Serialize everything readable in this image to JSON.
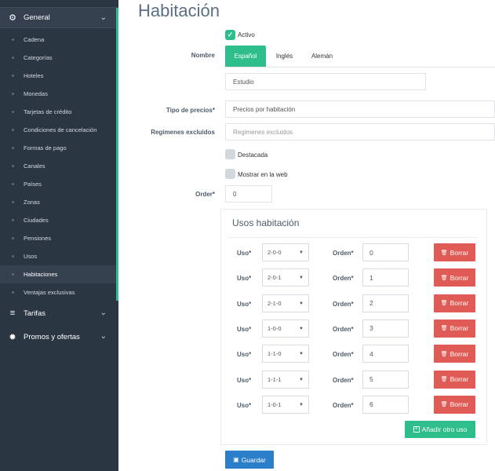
{
  "sidebar": {
    "general": {
      "label": "General",
      "icon": "cogs-icon"
    },
    "items": [
      {
        "label": "Cadena"
      },
      {
        "label": "Categorías"
      },
      {
        "label": "Hoteles"
      },
      {
        "label": "Monedas"
      },
      {
        "label": "Tarjetas de crédito"
      },
      {
        "label": "Condiciones de cancelación"
      },
      {
        "label": "Formas de pago"
      },
      {
        "label": "Canales"
      },
      {
        "label": "Países"
      },
      {
        "label": "Zonas"
      },
      {
        "label": "Ciudades"
      },
      {
        "label": "Pensiones"
      },
      {
        "label": "Usos"
      },
      {
        "label": "Habitaciones",
        "active": true
      },
      {
        "label": "Ventajas exclusivas"
      }
    ],
    "tarifas": {
      "label": "Tarifas",
      "icon": "database-icon"
    },
    "promos": {
      "label": "Promos y ofertas",
      "icon": "gear-icon"
    }
  },
  "page": {
    "title": "Habitación"
  },
  "form": {
    "activo_label": "Activo",
    "nombre_label": "Nombre",
    "tabs": [
      "Español",
      "Inglés",
      "Alemán"
    ],
    "nombre_value": "Estudio",
    "tipo_precios_label": "Tipo de precios*",
    "tipo_precios_value": "Precios por habitación",
    "regimenes_label": "Regimenes excluidos",
    "regimenes_placeholder": "Regimenes excluidos",
    "destacada_label": "Destacada",
    "mostrar_label": "Mostrar en la web",
    "order_label": "Order*",
    "order_value": "0"
  },
  "usos": {
    "title": "Usos habitación",
    "uso_label": "Uso*",
    "orden_label": "Orden*",
    "delete_label": "Borrar",
    "rows": [
      {
        "uso": "2-0-0",
        "orden": "0"
      },
      {
        "uso": "2-0-1",
        "orden": "1"
      },
      {
        "uso": "2-1-0",
        "orden": "2"
      },
      {
        "uso": "1-0-0",
        "orden": "3"
      },
      {
        "uso": "1-1-0",
        "orden": "4"
      },
      {
        "uso": "1-1-1",
        "orden": "5"
      },
      {
        "uso": "1-0-1",
        "orden": "6"
      }
    ],
    "add_label": "Añadir otro uso"
  },
  "save_label": "Guardar",
  "colors": {
    "sidebar": "#2b3643",
    "accent": "#2dbe8c",
    "danger": "#e05b55",
    "primary": "#2a7fc8"
  }
}
